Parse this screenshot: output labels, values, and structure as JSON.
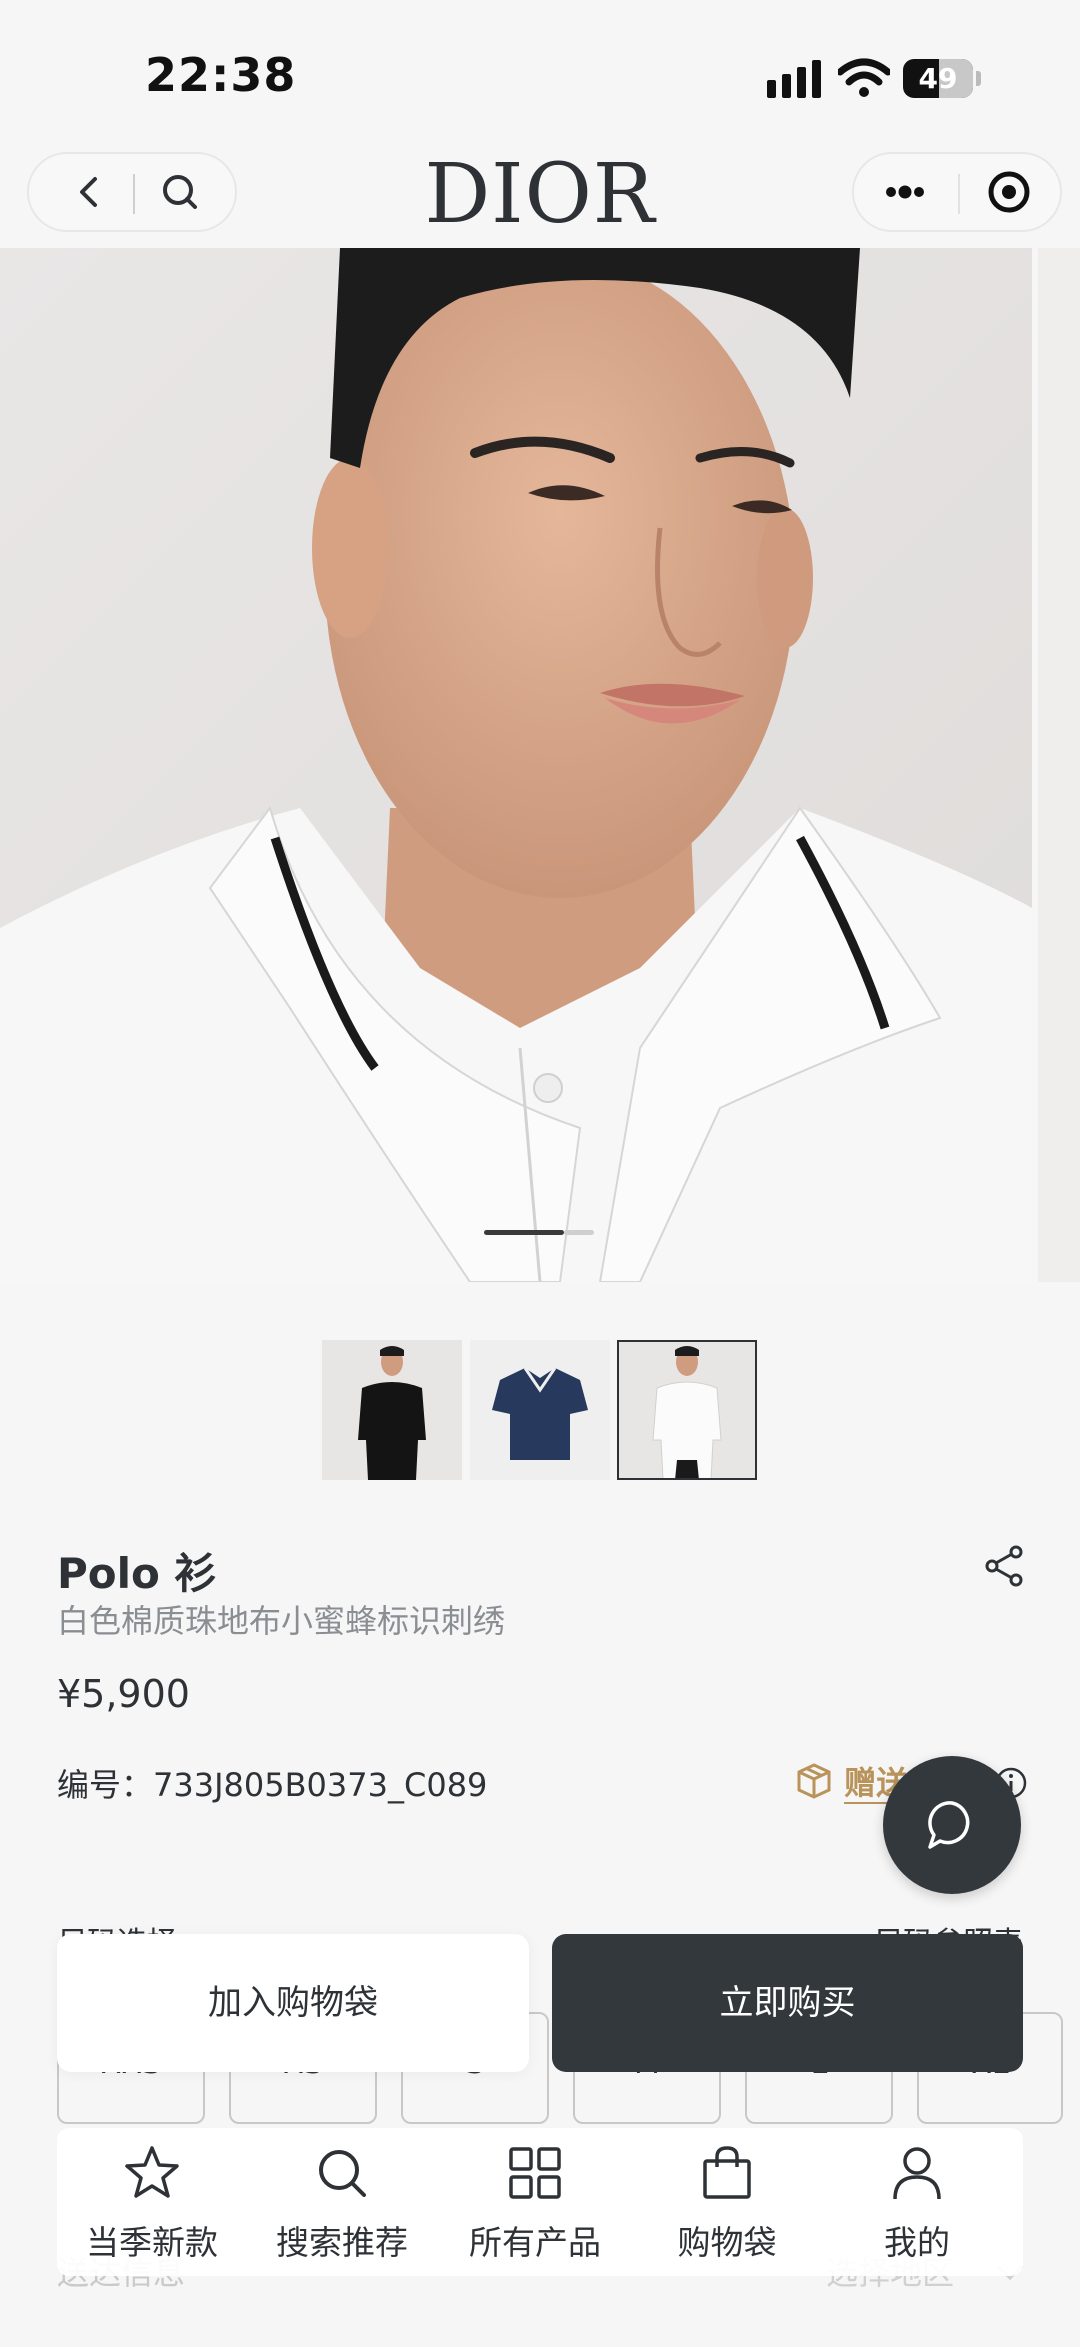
{
  "status_bar": {
    "time": "22:38",
    "battery": "49"
  },
  "nav": {
    "brand_logo": "DIOR"
  },
  "gallery": {
    "current_index": 0,
    "total": 3,
    "selected_thumbnail": 2
  },
  "product": {
    "title": "Polo 衫",
    "subtitle": "白色棉质珠地布小蜜蜂标识刺绣",
    "price": "¥5,900",
    "sku": "编号：733J805B0373_C089",
    "gift_label": "赠送"
  },
  "size": {
    "label": "尺码选择",
    "guide_link": "尺码参照表",
    "options": [
      "XXS",
      "XS",
      "S",
      "M",
      "L",
      "XL"
    ]
  },
  "delivery": {
    "label": "送达信息",
    "region_placeholder": "选择地区"
  },
  "actions": {
    "add_to_bag": "加入购物袋",
    "buy_now": "立即购买"
  },
  "tabbar": {
    "items": [
      {
        "label": "当季新款",
        "icon": "star-icon"
      },
      {
        "label": "搜索推荐",
        "icon": "search-icon"
      },
      {
        "label": "所有产品",
        "icon": "grid-icon"
      },
      {
        "label": "购物袋",
        "icon": "bag-icon"
      },
      {
        "label": "我的",
        "icon": "person-icon"
      }
    ]
  },
  "colors": {
    "accent": "#b9935a",
    "dark": "#33383c",
    "background": "#f6f6f6"
  }
}
